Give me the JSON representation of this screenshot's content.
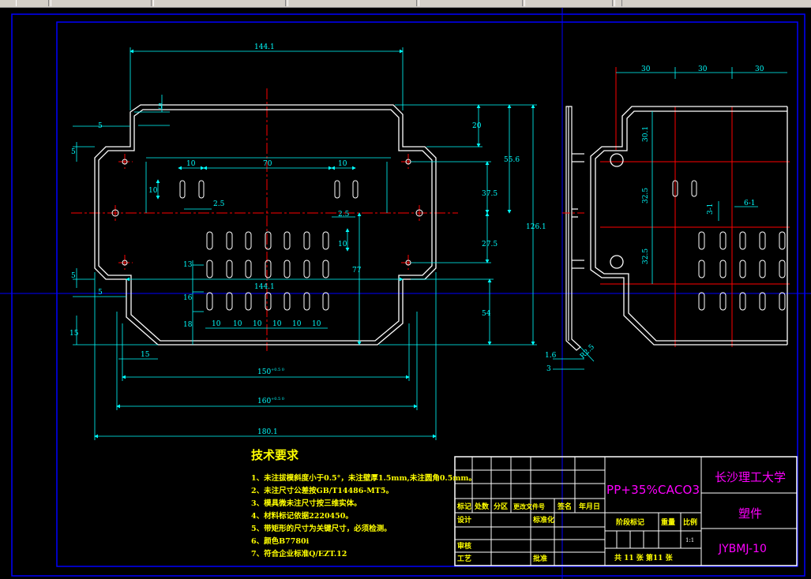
{
  "colors": {
    "background": "#000000",
    "outline": "#ffffff",
    "dimension": "#00ffff",
    "centerline": "#ff0000",
    "border": "#0000ff",
    "title_block": "#ffffff",
    "tech_text": "#ffff00",
    "material_text": "#ff00ff",
    "school_text": "#ff00ff"
  },
  "front_view": {
    "dims": {
      "width_top": "144.1",
      "top_small": "5",
      "left_notch": "5",
      "left_vert": "5",
      "d20": "20",
      "d55_6": "55.6",
      "d126_1": "126.1",
      "slot_w1": "10",
      "slot_span": "70",
      "slot_w2": "10",
      "slot_h": "10",
      "gap_2_5a": "2.5",
      "gap_2_5b": "2.5",
      "d37_5": "37.5",
      "d27_5": "27.5",
      "d10": "10",
      "d77": "77",
      "d13": "13",
      "d16": "16",
      "d18": "18",
      "inner_144": "144.1",
      "pitch": [
        "10",
        "10",
        "10",
        "10",
        "10",
        "10",
        "10"
      ],
      "d54": "54",
      "left_5b": "5",
      "left_5c": "5",
      "d15": "15",
      "d15b": "15",
      "d150": "150",
      "d160": "160",
      "d180": "180.1",
      "tol_150": "+0.5 0",
      "tol_160": "+0.5 0"
    }
  },
  "side_view": {
    "dims": {
      "d1_6": "1.6",
      "d3": "3",
      "r2_5": "R2.5"
    }
  },
  "right_view": {
    "dims": {
      "top": [
        "30",
        "30",
        "30"
      ],
      "d30_1": "30.1",
      "d32_5a": "32.5",
      "d32_5b": "32.5",
      "d3_1": "3-1",
      "d6_1": "6-1"
    }
  },
  "tech": {
    "title": "技术要求",
    "items": [
      "1、未注拔模斜度小于0.5°，未注壁厚1.5mm,未注圆角0.5mm。",
      "2、未注尺寸公差按GB/T14486-MT5。",
      "3、模具微未注尺寸按三维实体。",
      "4、材料标记依据2220450。",
      "5、带矩形的尺寸为关键尺寸，必须检测。",
      "6、颜色B7780i",
      "7、符合企业标准Q/EZT.12"
    ]
  },
  "title_block": {
    "material": "PP+35%CACO3",
    "school": "长沙理工大学",
    "part_name": "塑件",
    "drawing_no": "JYBMJ-10",
    "headers": [
      "标记",
      "处数",
      "分区",
      "更改文件号",
      "签名",
      "年月日"
    ],
    "design": "设计",
    "standardize": "标准化",
    "review": "审核",
    "process": "工艺",
    "approve": "批准",
    "stage_mark": "阶段标记",
    "weight": "重量",
    "scale": "比例",
    "scale_value": "1:1",
    "sheets": "共 11 张  第11 张"
  }
}
